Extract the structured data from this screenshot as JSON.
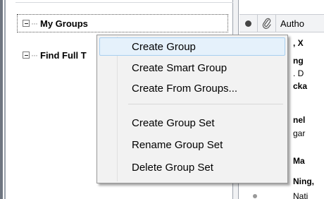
{
  "tree": {
    "my_groups": "My Groups",
    "find_full_text": "Find Full T"
  },
  "reference_list": {
    "author_header": "Autho",
    "rows": [
      ", X",
      "ng",
      ". D",
      "cka",
      "nel",
      "gar",
      "Ma",
      "Ning,",
      "Nati"
    ]
  },
  "context_menu": {
    "items": [
      "Create Group",
      "Create Smart Group",
      "Create From Groups...",
      "Create Group Set",
      "Rename Group Set",
      "Delete Group Set"
    ]
  }
}
